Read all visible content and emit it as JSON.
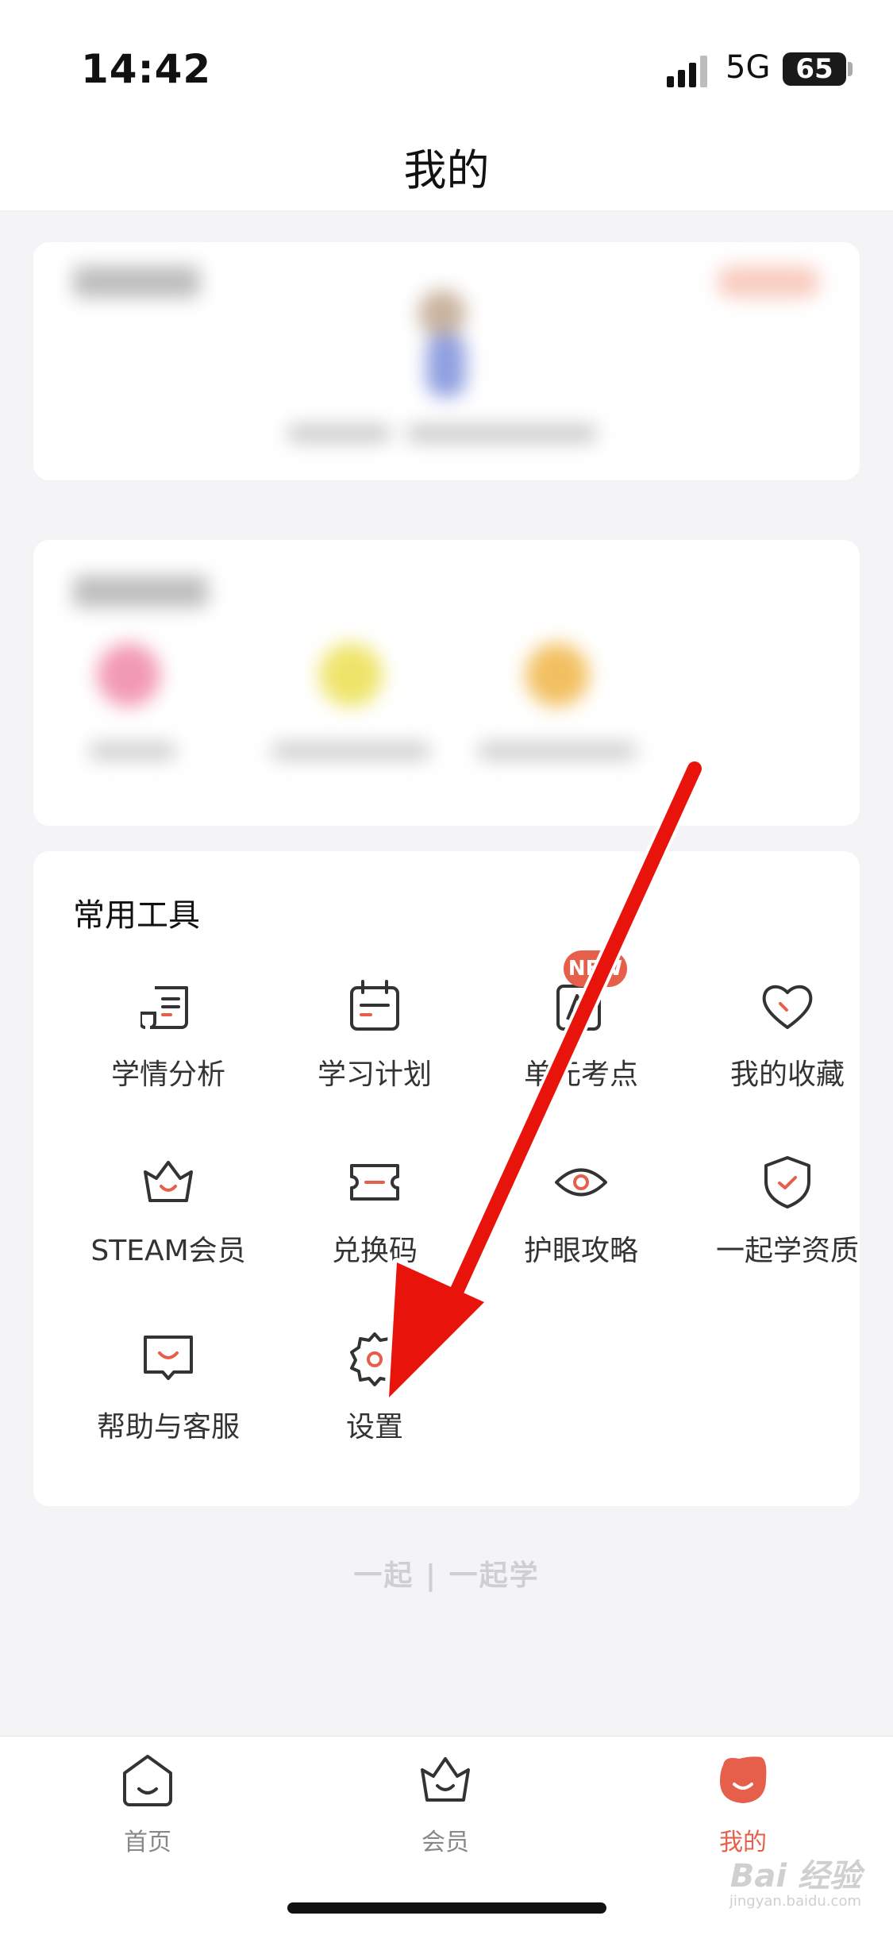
{
  "status_bar": {
    "time": "14:42",
    "network": "5G",
    "battery": "65"
  },
  "header": {
    "title": "我的"
  },
  "tools": {
    "title": "常用工具",
    "new_badge": "NEW",
    "items": [
      {
        "label": "学情分析",
        "icon": "report-icon"
      },
      {
        "label": "学习计划",
        "icon": "calendar-icon"
      },
      {
        "label": "单元考点",
        "icon": "exam-point-icon"
      },
      {
        "label": "我的收藏",
        "icon": "heart-icon"
      },
      {
        "label": "STEAM会员",
        "icon": "crown-icon"
      },
      {
        "label": "兑换码",
        "icon": "ticket-icon"
      },
      {
        "label": "护眼攻略",
        "icon": "eye-icon"
      },
      {
        "label": "一起学资质",
        "icon": "shield-icon"
      },
      {
        "label": "帮助与客服",
        "icon": "help-chat-icon"
      },
      {
        "label": "设置",
        "icon": "gear-icon"
      }
    ]
  },
  "footer_logo": "一起 | 一起学",
  "tab_bar": {
    "tabs": [
      {
        "label": "首页",
        "icon": "home-icon"
      },
      {
        "label": "会员",
        "icon": "crown-icon"
      },
      {
        "label": "我的",
        "icon": "profile-icon",
        "active": true
      }
    ]
  },
  "watermark": {
    "text": "Bai 经验",
    "sub": "jingyan.baidu.com"
  },
  "colors": {
    "accent": "#e65f4a",
    "annotation_arrow": "#e8140c",
    "page_bg": "#f4f4f6"
  }
}
